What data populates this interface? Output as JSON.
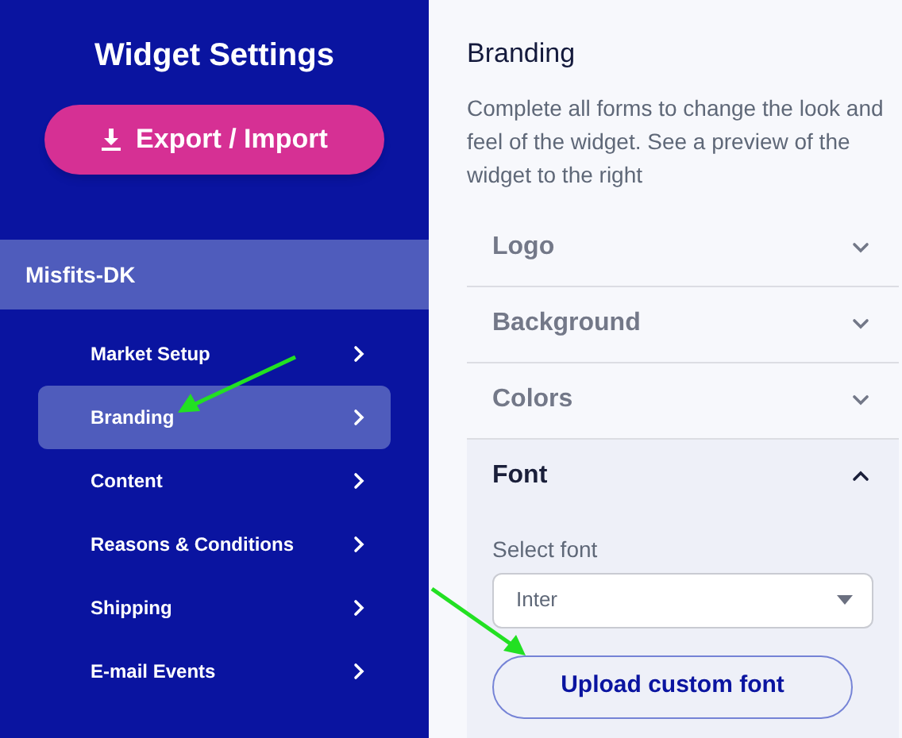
{
  "sidebar": {
    "title": "Widget Settings",
    "action_button": {
      "label": "Export / Import"
    },
    "group": {
      "label": "Misfits-DK",
      "items": [
        {
          "label": "Market Setup",
          "selected": false
        },
        {
          "label": "Branding",
          "selected": true
        },
        {
          "label": "Content",
          "selected": false
        },
        {
          "label": "Reasons & Conditions",
          "selected": false
        },
        {
          "label": "Shipping",
          "selected": false
        },
        {
          "label": "E-mail Events",
          "selected": false
        }
      ]
    }
  },
  "content": {
    "title": "Branding",
    "description": "Complete all forms to change the look and feel of the widget. See a preview of the widget to the right",
    "sections": [
      {
        "label": "Logo",
        "expanded": false
      },
      {
        "label": "Background",
        "expanded": false
      },
      {
        "label": "Colors",
        "expanded": false
      },
      {
        "label": "Font",
        "expanded": true,
        "field_label": "Select font",
        "select_value": "Inter",
        "button": "Upload custom font"
      }
    ]
  }
}
